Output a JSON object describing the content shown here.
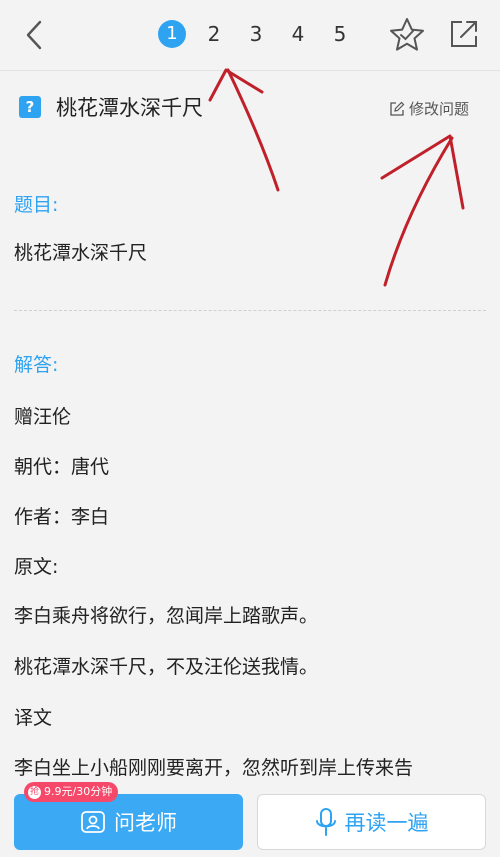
{
  "nav": {
    "pages": [
      "1",
      "2",
      "3",
      "4",
      "5"
    ],
    "active_page": "1"
  },
  "question": {
    "badge": "?",
    "title": "桃花潭水深千尺",
    "edit_label": "修改问题"
  },
  "content": {
    "prompt_label": "题目:",
    "prompt_text": "桃花潭水深千尺",
    "answer_label": "解答:",
    "lines": [
      "赠汪伦",
      "朝代：唐代",
      "作者：李白",
      "原文:",
      "李白乘舟将欲行，忽闻岸上踏歌声。",
      "桃花潭水深千尺，不及汪伦送我情。",
      "译文",
      "李白坐上小船刚刚要离开，忽然听到岸上传来告"
    ]
  },
  "bottom": {
    "price_badge": "9.9元/30分钟",
    "price_icon": "抢",
    "ask_label": "问老师",
    "read_label": "再读一遍"
  },
  "colors": {
    "accent": "#2ea3f2",
    "annotation": "#c0202a"
  }
}
